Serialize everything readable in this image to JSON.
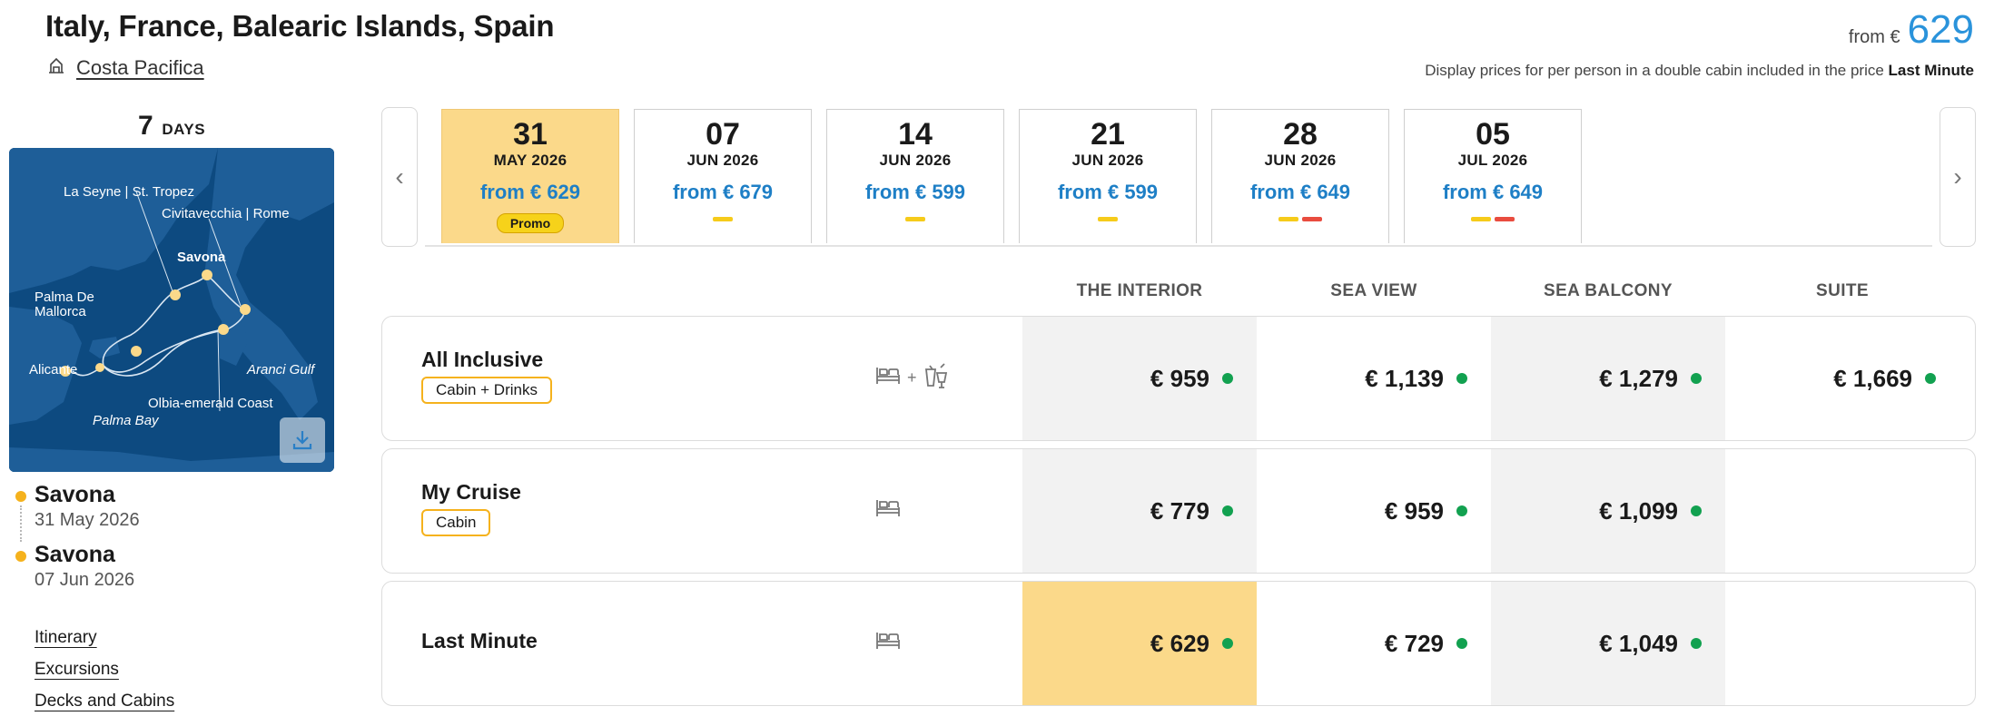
{
  "header": {
    "title": "Italy, France, Balearic Islands, Spain",
    "ship_name": "Costa Pacifica",
    "price_from_label": "from €",
    "price_from_value": "629",
    "price_note_prefix": "Display prices for per person in a double cabin included in the price",
    "price_note_fare": "Last Minute"
  },
  "itinerary": {
    "days_number": "7",
    "days_label": "DAYS",
    "map_labels": {
      "la_seyne": "La Seyne | St. Tropez",
      "civitavecchia": "Civitavecchia | Rome",
      "savona": "Savona",
      "palma_de_mallorca_1": "Palma De",
      "palma_de_mallorca_2": "Mallorca",
      "alicante": "Alicante",
      "aranci": "Aranci Gulf",
      "olbia": "Olbia-emerald Coast",
      "palma_bay": "Palma Bay"
    },
    "stops": [
      {
        "city": "Savona",
        "date": "31 May 2026"
      },
      {
        "city": "Savona",
        "date": "07 Jun 2026"
      }
    ],
    "links": [
      "Itinerary",
      "Excursions",
      "Decks and Cabins"
    ]
  },
  "dates": [
    {
      "day": "31",
      "month": "MAY 2026",
      "price": "from € 629",
      "badge": "Promo",
      "active": true,
      "bars": []
    },
    {
      "day": "07",
      "month": "JUN 2026",
      "price": "from € 679",
      "bars": [
        "yellow"
      ]
    },
    {
      "day": "14",
      "month": "JUN 2026",
      "price": "from € 599",
      "bars": [
        "yellow"
      ]
    },
    {
      "day": "21",
      "month": "JUN 2026",
      "price": "from € 599",
      "bars": [
        "yellow"
      ]
    },
    {
      "day": "28",
      "month": "JUN 2026",
      "price": "from € 649",
      "bars": [
        "yellow",
        "red"
      ]
    },
    {
      "day": "05",
      "month": "JUL 2026",
      "price": "from € 649",
      "bars": [
        "yellow",
        "red"
      ]
    }
  ],
  "carousel": {
    "prev_icon": "chevron-left-icon",
    "next_icon": "chevron-right-icon"
  },
  "cabin_types": [
    "THE INTERIOR",
    "SEA VIEW",
    "SEA BALCONY",
    "SUITE"
  ],
  "fares": [
    {
      "name": "All Inclusive",
      "tag": "Cabin + Drinks",
      "icons": [
        "bed-icon",
        "drinks-icon"
      ],
      "icon_joiner": "+",
      "prices": [
        "€ 959",
        "€ 1,139",
        "€ 1,279",
        "€ 1,669"
      ]
    },
    {
      "name": "My Cruise",
      "tag": "Cabin",
      "icons": [
        "bed-icon"
      ],
      "prices": [
        "€ 779",
        "€ 959",
        "€ 1,099",
        ""
      ]
    },
    {
      "name": "Last Minute",
      "tag": "",
      "icons": [
        "bed-icon"
      ],
      "prices": [
        "€ 629",
        "€ 729",
        "€ 1,049",
        ""
      ]
    }
  ],
  "colors": {
    "accent_yellow": "#fbd98a",
    "price_blue": "#1e7fc6",
    "availability_green": "#12a150",
    "bar_yellow": "#f6cb1a",
    "bar_red": "#e94c3f"
  }
}
